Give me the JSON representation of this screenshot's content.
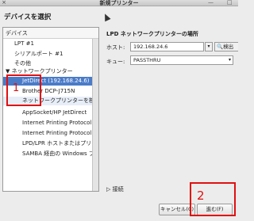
{
  "window": {
    "close_glyph": "×",
    "title": "新規プリンター",
    "ctrl_left": "—",
    "ctrl_right": "□"
  },
  "heading": "デバイスを選択",
  "device_tree": {
    "header": "デバイス",
    "items": [
      {
        "label": "LPT #1",
        "indent": 1
      },
      {
        "label": "シリアルポート #1",
        "indent": 1
      },
      {
        "label": "その他",
        "indent": 1
      },
      {
        "label": "▼ ネットワークプリンター",
        "indent": 0
      },
      {
        "label": "JetDirect (192.168.24.6)",
        "indent": 2,
        "state": "selected"
      },
      {
        "label": "Brother DCP-J715N",
        "indent": 2
      },
      {
        "label": "ネットワークプリンターを検索",
        "indent": 2,
        "state": "hi"
      },
      {
        "label": "AppSocket/HP JetDirect",
        "indent": 2
      },
      {
        "label": "Internet Printing Protocol (ipp)",
        "indent": 2
      },
      {
        "label": "Internet Printing Protocol (https)",
        "indent": 2
      },
      {
        "label": "LPD/LPR ホストまたはプリンター",
        "indent": 2
      },
      {
        "label": "SAMBA 経由の Windows プリンター",
        "indent": 2
      }
    ]
  },
  "lpd": {
    "title": "LPD ネットワークプリンターの場所",
    "host_label": "ホスト:",
    "host_value": "192.168.24.6",
    "probe_label": "検出",
    "queue_label": "キュー:",
    "queue_value": "PASSTHRU"
  },
  "connection_expander": "▷ 接続",
  "buttons": {
    "cancel": "キャンセル(C)",
    "forward": "進む(F)"
  },
  "annotations": {
    "num1": "1",
    "num2": "2",
    "color": "#e01010"
  }
}
